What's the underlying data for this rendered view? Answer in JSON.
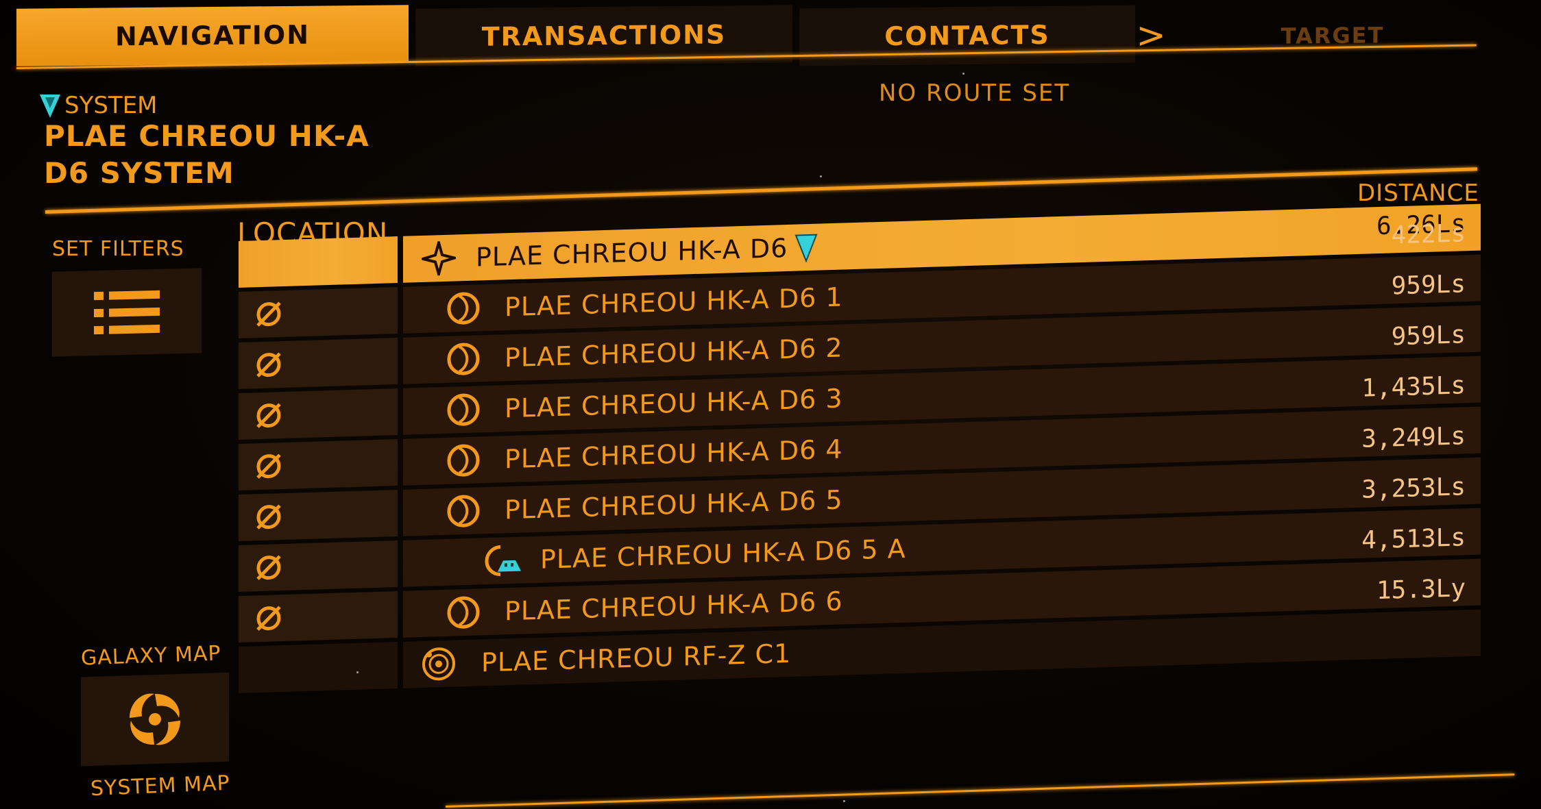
{
  "tabs": {
    "navigation": "NAVIGATION",
    "transactions": "TRANSACTIONS",
    "contacts": "CONTACTS",
    "more": ">",
    "target": "TARGET"
  },
  "header": {
    "system_label": "SYSTEM",
    "system_name_line1": "PLAE CHREOU HK-A",
    "system_name_line2": "D6 SYSTEM",
    "route_status": "NO ROUTE SET"
  },
  "columns": {
    "location": "LOCATION",
    "distance": "DISTANCE"
  },
  "sidebar": {
    "set_filters": "SET FILTERS",
    "galaxy_map": "GALAXY MAP",
    "system_map": "SYSTEM MAP"
  },
  "rows": [
    {
      "name": "PLAE CHREOU HK-A D6",
      "distance": "6.26Ls",
      "icon": "star-icon",
      "selected": true,
      "current": true
    },
    {
      "name": "PLAE CHREOU HK-A D6 1",
      "distance": "422Ls",
      "icon": "planet-icon",
      "cat_icon": "no-landing-icon"
    },
    {
      "name": "PLAE CHREOU HK-A D6 2",
      "distance": "959Ls",
      "icon": "planet-icon",
      "cat_icon": "no-landing-icon"
    },
    {
      "name": "PLAE CHREOU HK-A D6 3",
      "distance": "959Ls",
      "icon": "planet-icon",
      "cat_icon": "no-landing-icon"
    },
    {
      "name": "PLAE CHREOU HK-A D6 4",
      "distance": "1,435Ls",
      "icon": "planet-icon",
      "cat_icon": "no-landing-icon"
    },
    {
      "name": "PLAE CHREOU HK-A D6 5",
      "distance": "3,249Ls",
      "icon": "planet-icon",
      "cat_icon": "no-landing-icon"
    },
    {
      "name": "PLAE CHREOU HK-A D6 5 A",
      "distance": "3,253Ls",
      "icon": "landable-planet-icon",
      "cat_icon": "no-landing-icon"
    },
    {
      "name": "PLAE CHREOU HK-A D6 6",
      "distance": "4,513Ls",
      "icon": "planet-icon",
      "cat_icon": "no-landing-icon"
    },
    {
      "name": "PLAE CHREOU RF-Z C1",
      "distance": "15.3Ly",
      "icon": "system-icon"
    }
  ],
  "colors": {
    "accent": "#f39a1c",
    "panel": "#2a1709",
    "marker": "#35d0d8"
  }
}
